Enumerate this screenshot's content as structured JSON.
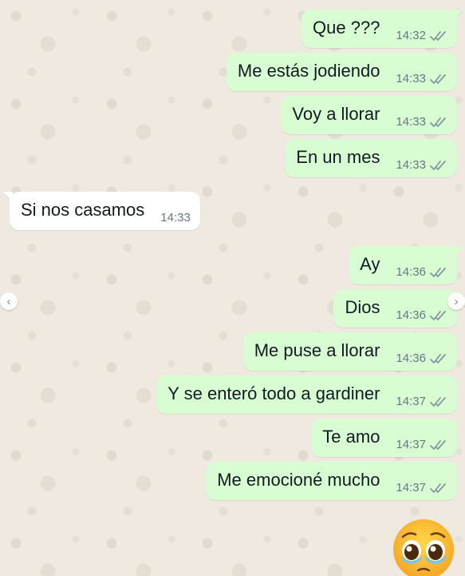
{
  "messages": [
    {
      "direction": "out",
      "text": "Que ???",
      "time": "14:32",
      "status": "read"
    },
    {
      "direction": "out",
      "text": "Me estás jodiendo",
      "time": "14:33",
      "status": "read"
    },
    {
      "direction": "out",
      "text": "Voy a llorar",
      "time": "14:33",
      "status": "read"
    },
    {
      "direction": "out",
      "text": "En un mes",
      "time": "14:33",
      "status": "read"
    },
    {
      "direction": "in",
      "text": "Si nos casamos",
      "time": "14:33"
    },
    {
      "direction": "out",
      "text": "Ay",
      "time": "14:36",
      "status": "read"
    },
    {
      "direction": "out",
      "text": "Dios",
      "time": "14:36",
      "status": "read"
    },
    {
      "direction": "out",
      "text": "Me puse a llorar",
      "time": "14:36",
      "status": "read"
    },
    {
      "direction": "out",
      "text": "Y se enteró todo a gardiner",
      "time": "14:37",
      "status": "read"
    },
    {
      "direction": "out",
      "text": "Te amo",
      "time": "14:37",
      "status": "read"
    },
    {
      "direction": "out",
      "text": "Me emocioné mucho",
      "time": "14:37",
      "status": "read"
    }
  ],
  "sticker": {
    "emoji": "pleading-face",
    "glyph": "🥹"
  },
  "nav": {
    "left": "‹",
    "right": "›"
  },
  "colors": {
    "outgoing_bubble": "#d9fdd3",
    "incoming_bubble": "#ffffff",
    "wallpaper": "#efe9df",
    "timestamp": "#667781",
    "read_tick": "#8696a0"
  }
}
